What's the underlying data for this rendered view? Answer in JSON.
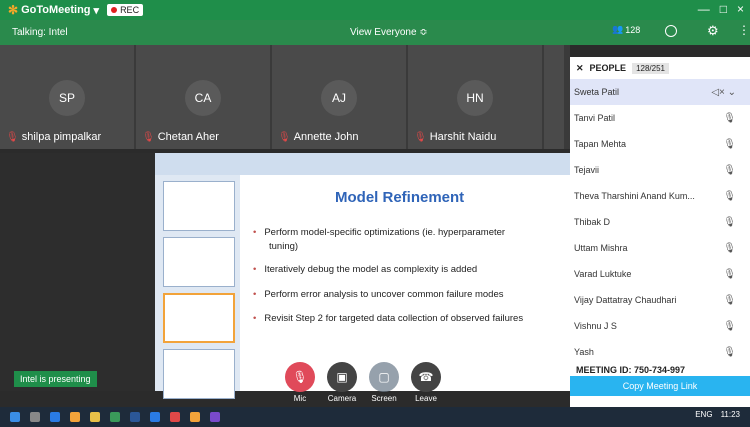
{
  "app": {
    "name": "GoToMeeting",
    "rec": "REC",
    "winctl": [
      "—",
      "□",
      "×"
    ]
  },
  "talking": "Talking: Intel",
  "view": "View Everyone ≎",
  "people_count": "128",
  "tiles": [
    {
      "initials": "SP",
      "name": "shilpa pimpalkar"
    },
    {
      "initials": "CA",
      "name": "Chetan Aher"
    },
    {
      "initials": "AJ",
      "name": "Annette John"
    },
    {
      "initials": "HN",
      "name": "Harshit Naidu"
    }
  ],
  "slide": {
    "title": "Model Refinement",
    "bullets": [
      "Perform model-specific optimizations (ie. hyperparameter",
      "tuning)",
      "Iteratively debug the model as complexity is added",
      "Perform error analysis to uncover common failure modes",
      "Revisit Step 2 for targeted data collection of observed failures"
    ]
  },
  "presenting": "Intel is presenting",
  "controls": [
    "Mic",
    "Camera",
    "Screen",
    "Leave"
  ],
  "panel": {
    "title": "PEOPLE",
    "count": "128/251",
    "people": [
      "Sweta Patil",
      "Tanvi Patil",
      "Tapan Mehta",
      "Tejavii",
      "Theva Tharshini Anand Kum...",
      "Thibak D",
      "Uttam Mishra",
      "Varad Luktuke",
      "Vijay Dattatray Chaudhari",
      "Vishnu J S",
      "Yash"
    ],
    "meeting_id": "MEETING ID: 750-734-997",
    "copy": "Copy Meeting Link"
  },
  "taskbar": {
    "lang": "ENG",
    "time": "11:23"
  }
}
